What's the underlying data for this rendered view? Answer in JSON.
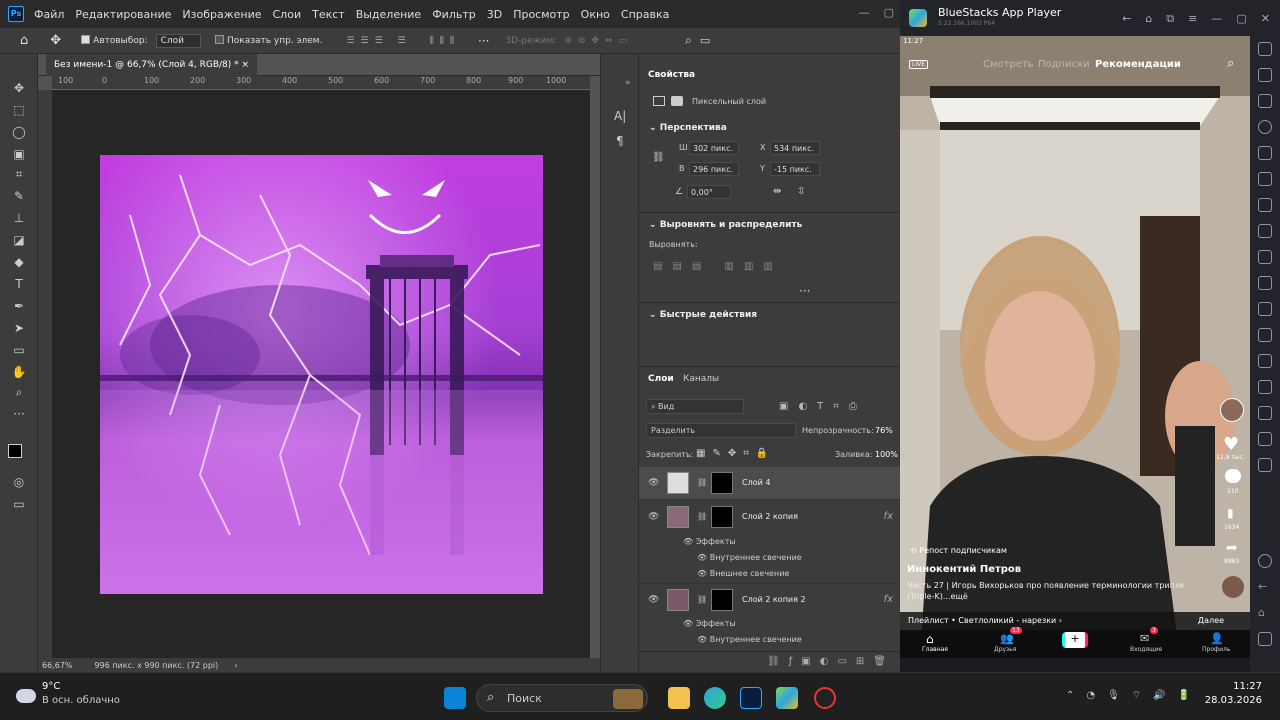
{
  "photoshop": {
    "logo": "Ps",
    "menu": [
      "Файл",
      "Редактирование",
      "Изображение",
      "Слои",
      "Текст",
      "Выделение",
      "Фильтр",
      "3D",
      "Просмотр",
      "Окно",
      "Справка"
    ],
    "options": {
      "autoselect_label": "Автовыбор:",
      "autoselect_value": "Слой",
      "show_controls_label": "Показать упр. элем.",
      "mode3d_label": "3D-режим:"
    },
    "document_tab": "Без имени-1 @ 66,7% (Слой 4, RGB/8) *",
    "ruler_top": [
      "100",
      "0",
      "100",
      "200",
      "300",
      "400",
      "500",
      "600",
      "700",
      "800",
      "900",
      "1000"
    ],
    "status": {
      "zoom": "66,67%",
      "size": "996 пикс. x 990 пикс. (72 ppi)"
    },
    "properties": {
      "tab": "Свойства",
      "kind": "Пиксельный слой",
      "section_transform": "Перспектива",
      "w_label": "Ш",
      "w_value": "302 пикс.",
      "h_label": "В",
      "h_value": "296 пикс.",
      "x_label": "X",
      "x_value": "534 пикс.",
      "y_label": "Y",
      "y_value": "-15 пикс.",
      "angle_value": "0,00°",
      "section_align": "Выровнять и распределить",
      "align_label": "Выровнять:",
      "section_quick": "Быстрые действия"
    },
    "layers_panel": {
      "tabs": [
        "Слои",
        "Каналы"
      ],
      "filter": "Вид",
      "blend_mode": "Разделить",
      "opacity_label": "Непрозрачность:",
      "opacity_value": "76%",
      "lock_label": "Закрепить:",
      "fill_label": "Заливка:",
      "fill_value": "100%",
      "layers": [
        {
          "name": "Слой 4",
          "fx": ""
        },
        {
          "name": "Слой 2 копия",
          "fx": "fx",
          "effects_label": "Эффекты",
          "effects": [
            "Внутреннее свечение",
            "Внешнее свечение"
          ]
        },
        {
          "name": "Слой 2 копия 2",
          "fx": "fx",
          "effects_label": "Эффекты",
          "effects": [
            "Внутреннее свечение"
          ]
        }
      ]
    }
  },
  "bluestacks": {
    "title": "BlueStacks App Player",
    "version": "5.22.166.1003 P64",
    "tiktok": {
      "time": "11:27",
      "live": "LIVE",
      "tabs": [
        "Смотреть",
        "Подписки",
        "Рекомендации"
      ],
      "repost": "Репост подписчикам",
      "author": "Иннокентий Петров",
      "caption": "Часть 27 | Игорь Вихорьков про появление терминологии триплк (Triple-K)...ещё",
      "playlist": "Плейлист • Светлоликий - нарезки",
      "next": "Далее",
      "counts": {
        "likes": "12,9 тыс.",
        "comments": "110",
        "saves": "1634",
        "shares": "8883"
      },
      "nav": [
        "Главная",
        "Друзья",
        "+",
        "Входящие",
        "Профиль"
      ],
      "badges": {
        "friends": "13",
        "inbox": "3"
      }
    }
  },
  "taskbar": {
    "weather_temp": "9°C",
    "weather_desc": "В осн. облачно",
    "search": "Поиск",
    "time": "11:27",
    "date": "28.03.2026"
  }
}
